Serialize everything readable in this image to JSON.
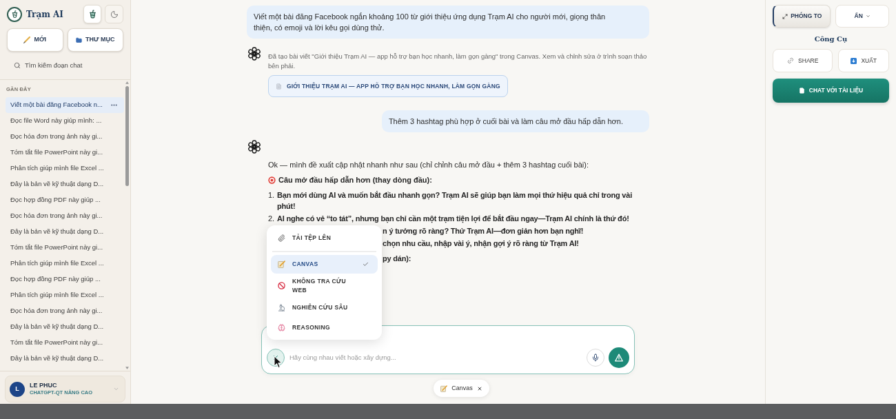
{
  "sidebar": {
    "brand": {
      "title": "Trạm AI"
    },
    "actions": [
      {
        "label": "MỚI",
        "kind": "new"
      },
      {
        "label": "THƯ MỤC",
        "kind": "folder"
      }
    ],
    "search": {
      "placeholder": "Tìm kiếm đoạn chat"
    },
    "section_title": "GẦN ĐÂY",
    "items": [
      {
        "label": "Viết một bài đăng Facebook n...",
        "selected": true
      },
      {
        "label": "Đọc file Word này giúp mình: ...",
        "selected": false
      },
      {
        "label": "Đọc hóa đơn trong ảnh này gi...",
        "selected": false
      },
      {
        "label": "Tóm tắt file PowerPoint này gi...",
        "selected": false
      },
      {
        "label": "Phân tích giúp mình file Excel ...",
        "selected": false
      },
      {
        "label": "Đây là bản vẽ kỹ thuật dạng D...",
        "selected": false
      },
      {
        "label": "Đọc hợp đồng PDF này giúp ...",
        "selected": false
      },
      {
        "label": "Đọc hóa đơn trong ảnh này gi...",
        "selected": false
      },
      {
        "label": "Đây là bản vẽ kỹ thuật dạng D...",
        "selected": false
      },
      {
        "label": "Tóm tắt file PowerPoint này gi...",
        "selected": false
      },
      {
        "label": "Phân tích giúp mình file Excel ...",
        "selected": false
      },
      {
        "label": "Đọc hợp đồng PDF này giúp ...",
        "selected": false
      },
      {
        "label": "Phân tích giúp mình file Excel ...",
        "selected": false
      },
      {
        "label": "Đọc hóa đơn trong ảnh này gi...",
        "selected": false
      },
      {
        "label": "Đây là bản vẽ kỹ thuật dạng D...",
        "selected": false
      },
      {
        "label": "Tóm tắt file PowerPoint này gi...",
        "selected": false
      },
      {
        "label": "Đây là bản vẽ kỹ thuật dạng D...",
        "selected": false
      }
    ],
    "user": {
      "initial": "L",
      "name": "LE PHUC",
      "plan": "CHATGPT-QT NÂNG CAO"
    }
  },
  "chat": {
    "messages": [
      {
        "kind": "user",
        "text": "Viết một bài đăng Facebook ngắn khoảng 100 từ giới thiệu ứng dụng Trạm AI cho người mới, giọng thân thiện, có emoji và lời kêu gọi dùng thử."
      },
      {
        "kind": "canvas_notice",
        "text": "Đã tạo bài viết \"Giới thiệu Trạm AI — app hỗ trợ bạn học nhanh, làm gọn gàng\" trong Canvas. Xem và chỉnh sửa ở trình soạn thảo bên phải.",
        "document": "GIỚI THIỆU TRẠM AI — APP HỖ TRỢ BẠN HỌC NHANH, LÀM GỌN GÀNG"
      },
      {
        "kind": "user",
        "text": "Thêm 3 hashtag phù hợp ở cuối bài và làm câu mở đầu hấp dẫn hơn."
      },
      {
        "kind": "reply",
        "intro": "Ok — mình đề xuất cập nhật nhanh như sau (chỉ chỉnh câu mở đầu + thêm 3 hashtag cuối bài):",
        "heading": "Câu mở đầu hấp dẫn hơn (thay dòng đầu):",
        "options": [
          {
            "number": "1.",
            "text": "Bạn mới dùng AI và muốn bắt đầu nhanh gọn? Trạm AI sẽ giúp bạn làm mọi thứ hiệu quả chỉ trong vài phút!"
          },
          {
            "number": "2.",
            "text": "AI nghe có vẻ “to tát”, nhưng bạn chỉ cần một trạm tiện lợi để bắt đầu ngay—Trạm AI chính là thứ đó!"
          }
        ],
        "partly_hidden": [
          {
            "kind": "list_item",
            "text": "n ý tưởng rõ ràng? Thử Trạm AI—đơn giản hơn bạn nghĩ!"
          },
          {
            "kind": "list_item",
            "text": "chọn nhu cầu, nhập vài ý, nhận gợi ý rõ ràng từ Trạm AI!"
          },
          {
            "kind": "heading",
            "text": "py dán):"
          }
        ]
      }
    ]
  },
  "composer": {
    "placeholder": "Hãy cùng nhau viết hoặc xây dựng...",
    "tools_menu": {
      "open": true,
      "items": [
        {
          "label": "TẢI TỆP LÊN",
          "kind": "upload",
          "selected": false
        },
        {
          "label": "CANVAS",
          "kind": "canvas",
          "selected": true
        },
        {
          "label": "KHÔNG TRA CỨU WEB",
          "kind": "no_web",
          "selected": false
        },
        {
          "label": "NGHIÊN CỨU SÂU",
          "kind": "deep_research",
          "selected": false
        },
        {
          "label": "REASONING",
          "kind": "reasoning",
          "selected": false
        }
      ]
    },
    "active_tool": {
      "label": "Canvas"
    }
  },
  "tools_panel": {
    "view_buttons": [
      {
        "label": "PHÓNG TO",
        "kind": "maximize",
        "active": true
      },
      {
        "label": "ẤN",
        "kind": "hide",
        "active": false
      }
    ],
    "title": "Công Cụ",
    "tools": [
      {
        "label": "SHARE",
        "kind": "share"
      },
      {
        "label": "XUẤT",
        "kind": "export"
      }
    ],
    "primary_action": {
      "label": "CHAT VỚI TÀI LIỆU"
    }
  }
}
